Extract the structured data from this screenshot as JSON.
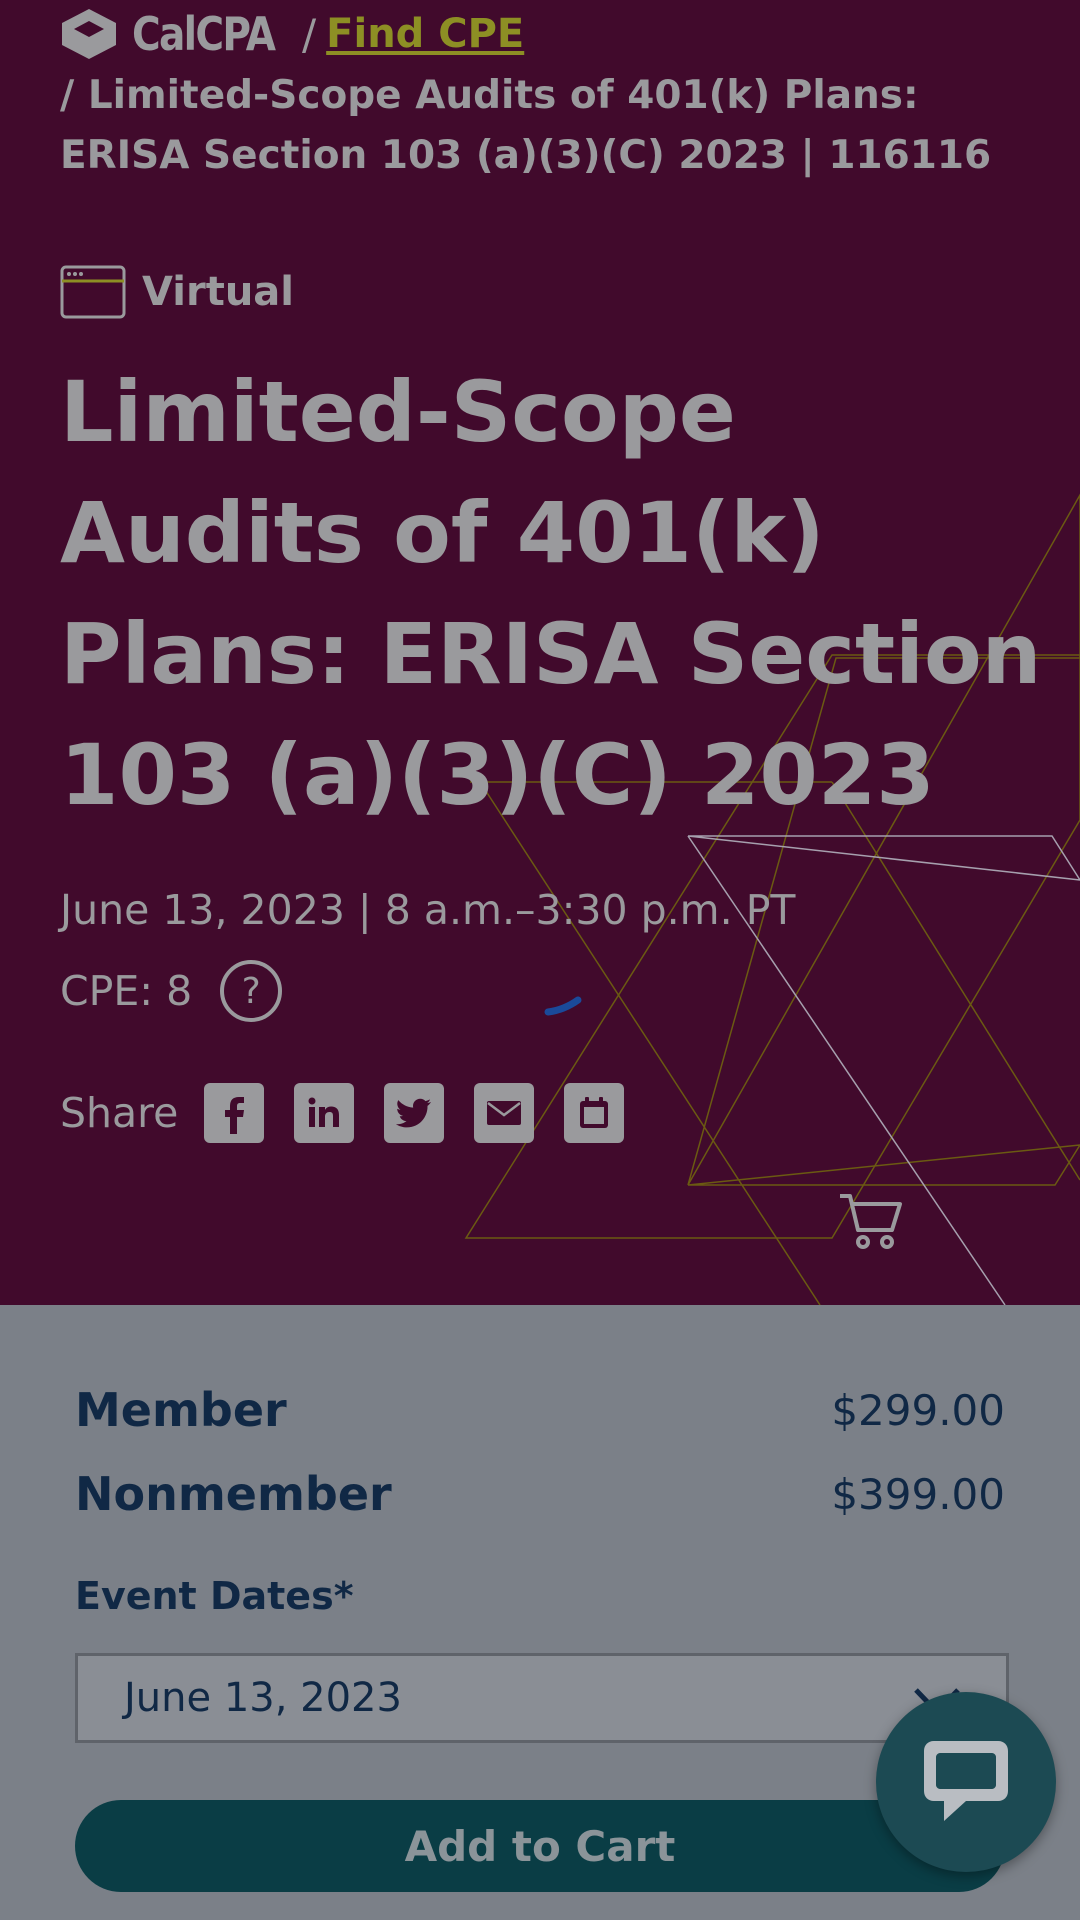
{
  "breadcrumb": {
    "logo_text": "CalCPA",
    "separator": "/",
    "parent_link": "Find CPE",
    "current": "/ Limited-Scope Audits of 401(k) Plans: ERISA Section 103 (a)(3)(C) 2023 | 116116"
  },
  "event": {
    "format": "Virtual",
    "title": "Limited-Scope Audits of 401(k) Plans: ERISA Section 103 (a)(3)(C) 2023",
    "datetime": "June 13, 2023 | 8 a.m.–3:30 p.m. PT",
    "cpe": "CPE: 8",
    "share_label": "Share",
    "share_icons": [
      "facebook-icon",
      "linkedin-icon",
      "twitter-icon",
      "email-icon",
      "calendar-icon"
    ]
  },
  "pricing": {
    "member_label": "Member",
    "member_price": "$299.00",
    "nonmember_label": "Nonmember",
    "nonmember_price": "$399.00"
  },
  "registration": {
    "dates_label": "Event Dates*",
    "selected_date": "June 13, 2023",
    "add_to_cart": "Add to Cart"
  },
  "colors": {
    "hero_bg": "#410a2c",
    "accent_link": "#8d8f24",
    "navy_text": "#102845",
    "button_bg": "#0a3d45"
  }
}
